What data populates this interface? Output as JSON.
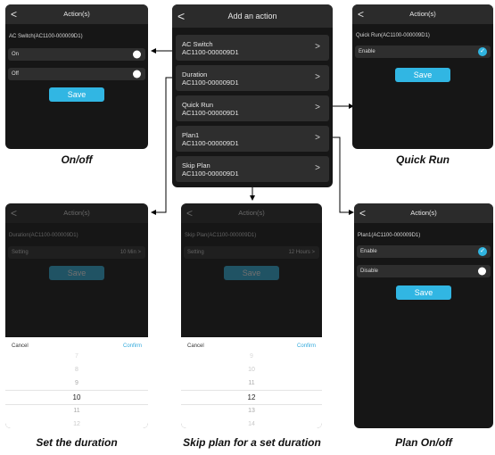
{
  "back_glyph": "<",
  "chevron_glyph": ">",
  "check_glyph": "✓",
  "colors": {
    "accent": "#31b6e3",
    "screen_bg": "#161616",
    "row_bg": "#2e2e2e",
    "topbar_bg": "#2b2b2b"
  },
  "center": {
    "title": "Add an action",
    "items": [
      {
        "line1": "AC Switch",
        "line2": "AC1100-000009D1"
      },
      {
        "line1": "Duration",
        "line2": "AC1100-000009D1"
      },
      {
        "line1": "Quick Run",
        "line2": "AC1100-000009D1"
      },
      {
        "line1": "Plan1",
        "line2": "AC1100-000009D1"
      },
      {
        "line1": "Skip Plan",
        "line2": "AC1100-000009D1"
      }
    ]
  },
  "onoff": {
    "title": "Action(s)",
    "subtitle": "AC Switch(AC1100-000009D1)",
    "options": [
      "On",
      "Off"
    ],
    "save": "Save",
    "caption": "On/off"
  },
  "quickrun": {
    "title": "Action(s)",
    "subtitle": "Quick Run(AC1100-000009D1)",
    "option": "Enable",
    "save": "Save",
    "caption": "Quick Run"
  },
  "duration": {
    "title": "Action(s)",
    "subtitle": "Duration(AC1100-000009D1)",
    "setting_label": "Setting",
    "setting_value": "10 Min >",
    "save": "Save",
    "cancel": "Cancel",
    "confirm": "Confirm",
    "values": [
      "7",
      "8",
      "9",
      "10",
      "11",
      "12",
      "13"
    ],
    "selected": "10",
    "caption": "Set the duration"
  },
  "skip": {
    "title": "Action(s)",
    "subtitle": "Skip Plan(AC1100-000009D1)",
    "setting_label": "Setting",
    "setting_value": "12 Hours >",
    "save": "Save",
    "cancel": "Cancel",
    "confirm": "Confirm",
    "values": [
      "9",
      "10",
      "11",
      "12",
      "13",
      "14",
      "15"
    ],
    "selected": "12",
    "caption": "Skip plan for a set duration"
  },
  "plan": {
    "title": "Action(s)",
    "subtitle": "Plan1(AC1100-000009D1)",
    "options": [
      "Enable",
      "Disable"
    ],
    "save": "Save",
    "caption": "Plan On/off"
  }
}
